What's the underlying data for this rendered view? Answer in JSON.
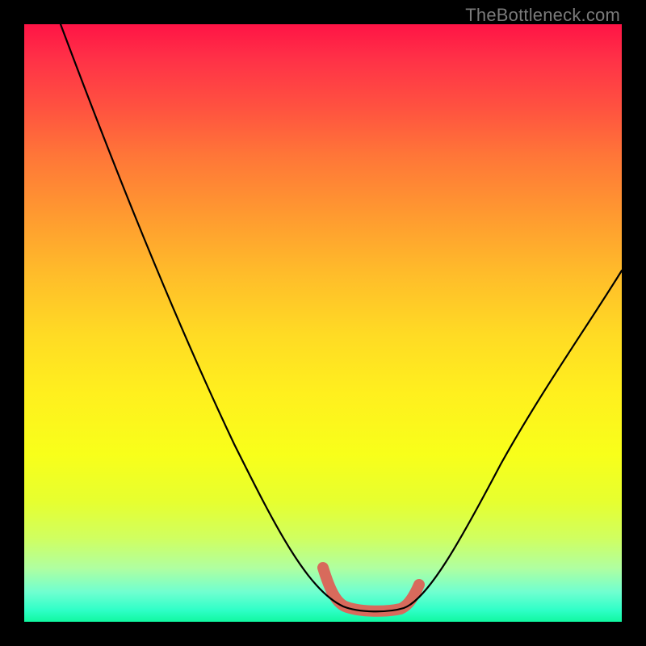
{
  "attribution": "TheBottleneck.com",
  "colors": {
    "frame": "#000000",
    "accent_stroke": "#d86a5c",
    "curve_stroke": "#000000",
    "gradient_top": "#ff1446",
    "gradient_bottom": "#10f8a0"
  },
  "chart_data": {
    "type": "line",
    "title": "",
    "xlabel": "",
    "ylabel": "",
    "xlim": [
      0,
      100
    ],
    "ylim": [
      0,
      100
    ],
    "legend": false,
    "annotations": [],
    "series": [
      {
        "name": "bottleneck-curve",
        "x": [
          6,
          10,
          14,
          18,
          22,
          26,
          30,
          34,
          38,
          42,
          46,
          50,
          52,
          54,
          56,
          58,
          60,
          62,
          64,
          68,
          72,
          76,
          80,
          84,
          88,
          92,
          96,
          100
        ],
        "values": [
          100,
          92,
          84,
          76,
          68,
          60,
          52,
          44,
          36,
          28,
          20,
          12,
          8,
          5,
          3,
          2,
          2,
          2,
          3,
          6,
          12,
          19,
          26,
          33,
          40,
          47,
          53,
          59
        ]
      }
    ],
    "accent_region_x": [
      50,
      65
    ],
    "notes": "V-shaped bottleneck curve over rainbow heat gradient; pink accent marks flat minimum region. Axes unlabeled; values in percent of plot extent."
  }
}
